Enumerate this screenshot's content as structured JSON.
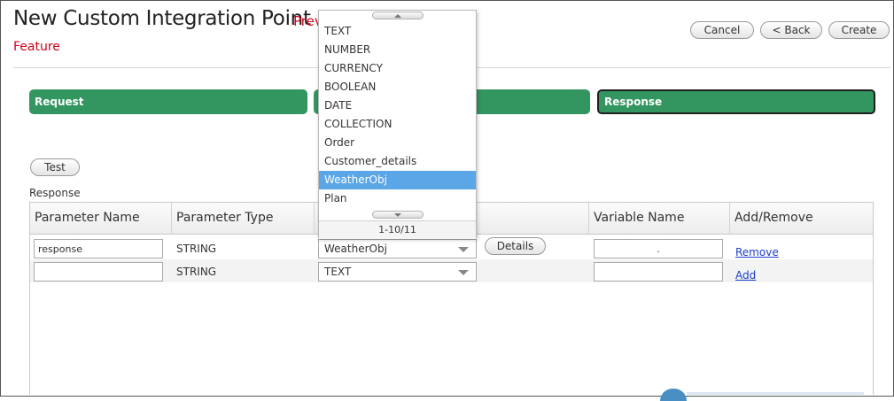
{
  "header": {
    "title": "New Custom Integration Point",
    "crumb_red": "Prev",
    "subtitle": "Feature",
    "buttons": {
      "cancel": "Cancel",
      "back": "< Back",
      "create": "Create"
    }
  },
  "steps": {
    "request": "Request",
    "middle": "",
    "response": "Response"
  },
  "test_button": "Test",
  "section_label": "Response",
  "table": {
    "headers": [
      "Parameter Name",
      "Parameter Type",
      "",
      "Variable Name",
      "Add/Remove"
    ],
    "rows": [
      {
        "param_name": "response",
        "param_type": "STRING",
        "data_type": "WeatherObj",
        "details": "Details",
        "variable_name": ".",
        "action": "Remove"
      },
      {
        "param_name": "",
        "param_type": "STRING",
        "data_type": "TEXT",
        "variable_name": "",
        "action": "Add"
      }
    ]
  },
  "dropdown": {
    "items": [
      "TEXT",
      "NUMBER",
      "CURRENCY",
      "BOOLEAN",
      "DATE",
      "COLLECTION",
      "Order",
      "Customer_details",
      "WeatherObj",
      "Plan"
    ],
    "selected": "WeatherObj",
    "pager": "1-10/11"
  },
  "colors": {
    "step_green": "#33955f",
    "link_blue": "#1a3ccc",
    "accent_red": "#d0021b",
    "selected_blue": "#5aa6e6"
  }
}
